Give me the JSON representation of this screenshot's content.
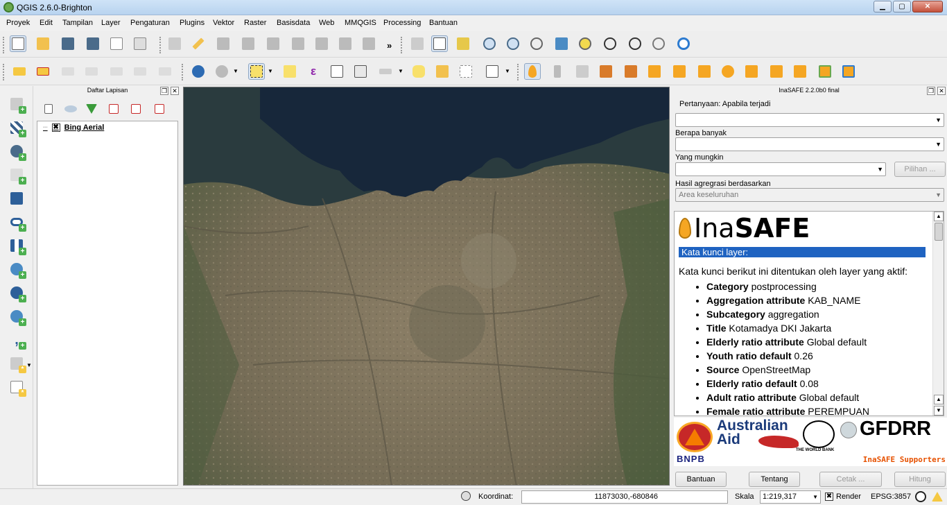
{
  "window": {
    "title": "QGIS 2.6.0-Brighton",
    "min": "▁",
    "max": "▢",
    "close": "✕"
  },
  "menu": [
    "Proyek",
    "Edit",
    "Tampilan",
    "Layer",
    "Pengaturan",
    "Plugins",
    "Vektor",
    "Raster",
    "Basisdata",
    "Web",
    "MMQGIS",
    "Processing",
    "Bantuan"
  ],
  "toolbar": {
    "more": "»"
  },
  "layers_panel": {
    "title": "Daftar Lapisan",
    "layer": {
      "name": "Bing Aerial",
      "checked": "✖"
    }
  },
  "inasafe": {
    "title": "InaSAFE 2.2.0b0 final",
    "q1_label": "Pertanyaan: Apabila terjadi",
    "q2_label": "Berapa banyak",
    "q3_label": "Yang mungkin",
    "pilihan_button": "Pilihan ...",
    "agg_label": "Hasil agregrasi berdasarkan",
    "agg_value": "Area keseluruhan",
    "logo_light": "Ina",
    "logo_bold": "SAFE",
    "report_heading": "Kata kunci layer:",
    "report_intro": "Kata kunci berikut ini ditentukan oleh layer yang aktif:",
    "keywords": [
      {
        "key": "Category",
        "value": "postprocessing"
      },
      {
        "key": "Aggregation attribute",
        "value": "KAB_NAME"
      },
      {
        "key": "Subcategory",
        "value": "aggregation"
      },
      {
        "key": "Title",
        "value": "Kotamadya DKI Jakarta"
      },
      {
        "key": "Elderly ratio attribute",
        "value": "Global default"
      },
      {
        "key": "Youth ratio default",
        "value": "0.26"
      },
      {
        "key": "Source",
        "value": "OpenStreetMap"
      },
      {
        "key": "Elderly ratio default",
        "value": "0.08"
      },
      {
        "key": "Adult ratio attribute",
        "value": "Global default"
      },
      {
        "key": "Female ratio attribute",
        "value": "PEREMPUAN"
      }
    ],
    "supporters": {
      "bnpb": "BNPB",
      "aus_line1": "Australian",
      "aus_line2": "Aid",
      "worldbank": "THE WORLD BANK",
      "gfdrr": "GFDRR",
      "label": "InaSAFE Supporters"
    },
    "buttons": {
      "help": "Bantuan",
      "about": "Tentang",
      "print": "Cetak ...",
      "run": "Hitung"
    }
  },
  "status": {
    "coord_label": "Koordinat:",
    "coord_value": "11873030,-680846",
    "scale_label": "Skala",
    "scale_value": "1:219,317",
    "render_label": "Render",
    "render_checked": "✖",
    "crs": "EPSG:3857"
  },
  "colors": {
    "accent": "#1f63c1",
    "brand_orange": "#f5a623",
    "sea": "#17273a"
  }
}
